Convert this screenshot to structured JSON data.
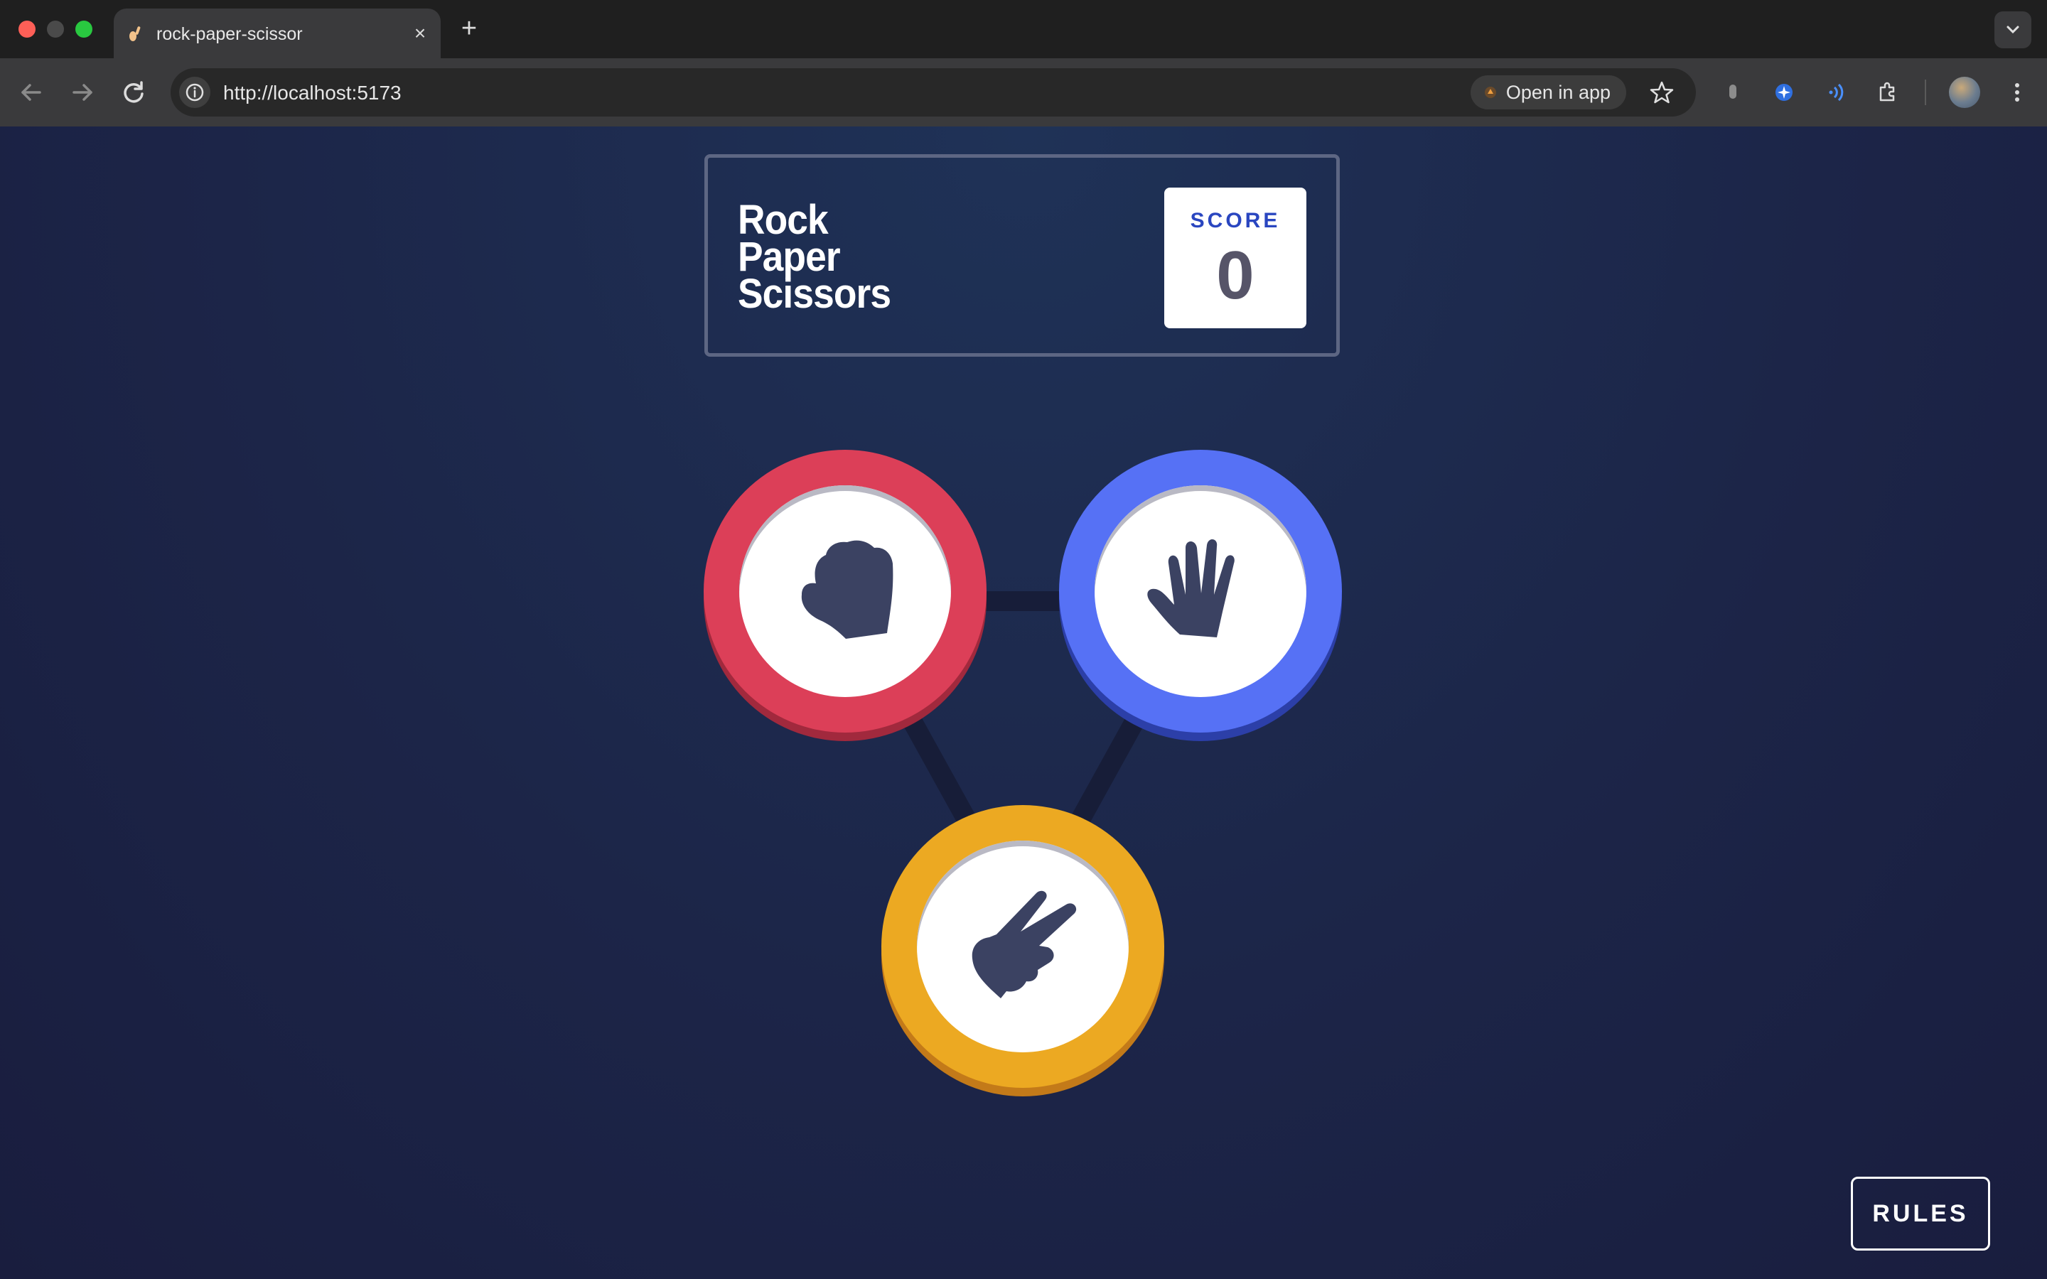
{
  "browser": {
    "tab_title": "rock-paper-scissor",
    "url": "http://localhost:5173",
    "open_in_app_label": "Open in app",
    "new_tab_symbol": "+",
    "close_tab_symbol": "×"
  },
  "header": {
    "title_lines": [
      "Rock",
      "Paper",
      "Scissors"
    ],
    "score_label": "SCORE",
    "score_value": "0"
  },
  "tokens": [
    {
      "name": "rock",
      "icon": "fist-icon",
      "color": "#dc3a55"
    },
    {
      "name": "paper",
      "icon": "open-hand-icon",
      "color": "#5671f5"
    },
    {
      "name": "scissors",
      "icon": "scissors-hand-icon",
      "color": "#eca922"
    }
  ],
  "rules_label": "RULES",
  "colors": {
    "background": "#1f2a4a",
    "icon_dark": "#3b4262",
    "score_text": "#2a46c0"
  }
}
